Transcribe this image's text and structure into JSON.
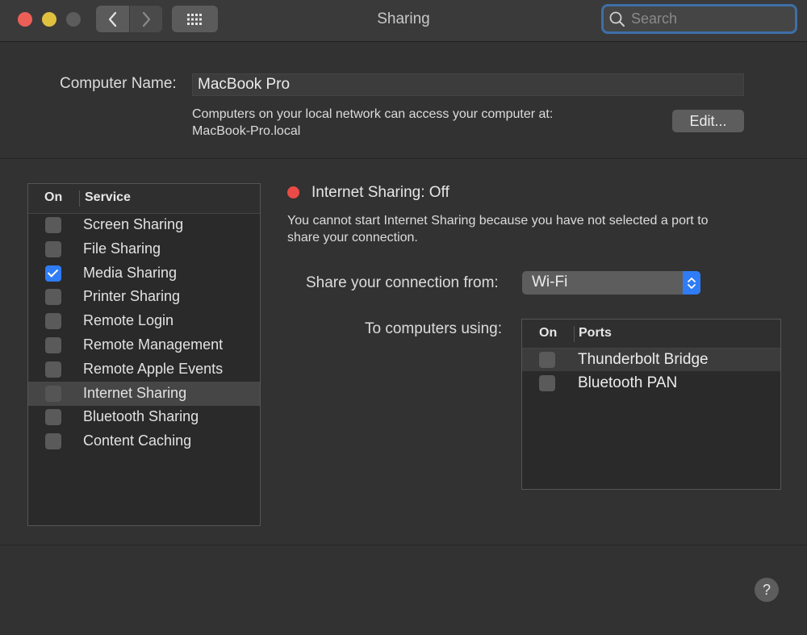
{
  "window": {
    "title": "Sharing"
  },
  "search": {
    "placeholder": "Search"
  },
  "computer_name": {
    "label": "Computer Name:",
    "value": "MacBook Pro",
    "description_line1": "Computers on your local network can access your computer at:",
    "description_line2": "MacBook-Pro.local",
    "edit_label": "Edit..."
  },
  "services": {
    "header_on": "On",
    "header_service": "Service",
    "items": [
      {
        "label": "Screen Sharing",
        "checked": false
      },
      {
        "label": "File Sharing",
        "checked": false
      },
      {
        "label": "Media Sharing",
        "checked": true
      },
      {
        "label": "Printer Sharing",
        "checked": false
      },
      {
        "label": "Remote Login",
        "checked": false
      },
      {
        "label": "Remote Management",
        "checked": false
      },
      {
        "label": "Remote Apple Events",
        "checked": false
      },
      {
        "label": "Internet Sharing",
        "checked": false,
        "selected": true
      },
      {
        "label": "Bluetooth Sharing",
        "checked": false
      },
      {
        "label": "Content Caching",
        "checked": false
      }
    ]
  },
  "detail": {
    "status": "Internet Sharing: Off",
    "status_color": "#eb4b46",
    "description_line1": "You cannot start Internet Sharing because you have not selected a port to",
    "description_line2": "share your connection.",
    "share_from_label": "Share your connection from:",
    "share_from_value": "Wi-Fi",
    "to_computers_label": "To computers using:",
    "ports_header_on": "On",
    "ports_header_ports": "Ports",
    "ports": [
      {
        "label": "Thunderbolt Bridge",
        "checked": false
      },
      {
        "label": "Bluetooth PAN",
        "checked": false
      }
    ]
  },
  "help": {
    "label": "?"
  },
  "colors": {
    "accent": "#2f7cf6",
    "focus_ring": "#3d6fa7"
  }
}
